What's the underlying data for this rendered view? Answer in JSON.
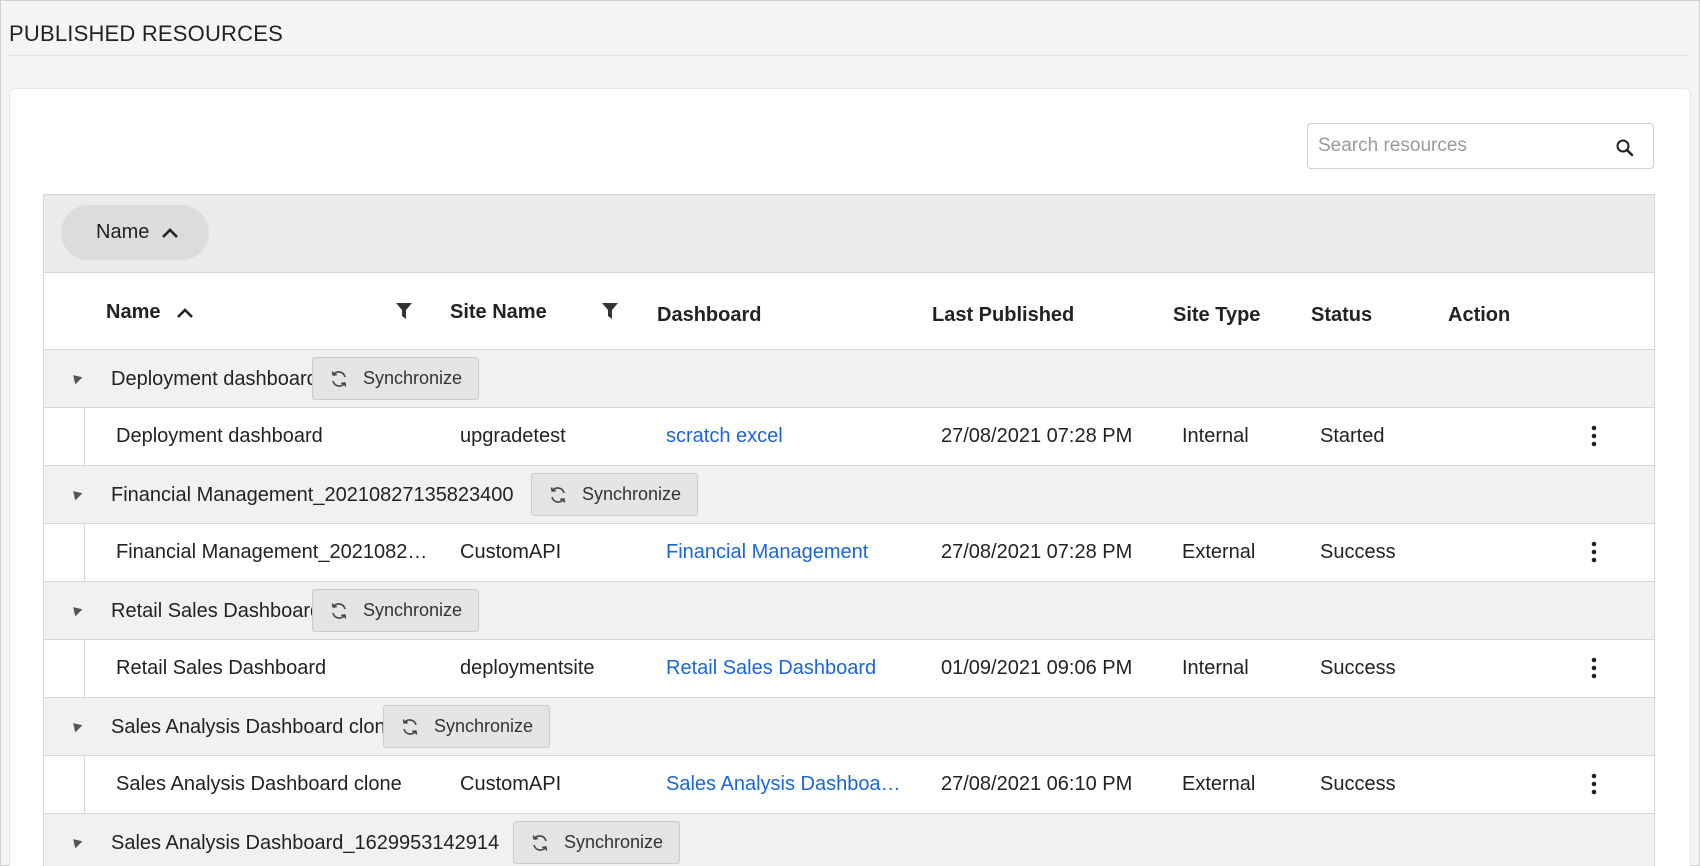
{
  "page": {
    "title": "PUBLISHED RESOURCES"
  },
  "search": {
    "placeholder": "Search resources"
  },
  "grouping": {
    "chip_label": "Name"
  },
  "columns": {
    "name": "Name",
    "site_name": "Site Name",
    "dashboard": "Dashboard",
    "last_published": "Last Published",
    "site_type": "Site Type",
    "status": "Status",
    "action": "Action"
  },
  "sync_label": "Synchronize",
  "groups": [
    {
      "title": "Deployment dashboard",
      "rows": [
        {
          "name": "Deployment dashboard",
          "site_name": "upgradetest",
          "dashboard": "scratch excel",
          "last_published": "27/08/2021 07:28 PM",
          "site_type": "Internal",
          "status": "Started"
        }
      ]
    },
    {
      "title": "Financial Management_20210827135823400",
      "rows": [
        {
          "name": "Financial Management_202108271…",
          "site_name": "CustomAPI",
          "dashboard": "Financial Management",
          "last_published": "27/08/2021 07:28 PM",
          "site_type": "External",
          "status": "Success"
        }
      ]
    },
    {
      "title": "Retail Sales Dashboard",
      "rows": [
        {
          "name": "Retail Sales Dashboard",
          "site_name": "deploymentsite",
          "dashboard": "Retail Sales Dashboard",
          "last_published": "01/09/2021 09:06 PM",
          "site_type": "Internal",
          "status": "Success"
        }
      ]
    },
    {
      "title": "Sales Analysis Dashboard clone",
      "rows": [
        {
          "name": "Sales Analysis Dashboard clone",
          "site_name": "CustomAPI",
          "dashboard": "Sales Analysis Dashboard …",
          "last_published": "27/08/2021 06:10 PM",
          "site_type": "External",
          "status": "Success"
        }
      ]
    },
    {
      "title": "Sales Analysis Dashboard_1629953142914",
      "rows": []
    }
  ],
  "colors": {
    "link": "#1a66d6",
    "group_row_bg": "#f1f1f1",
    "group_bar_bg": "#ebebeb"
  }
}
